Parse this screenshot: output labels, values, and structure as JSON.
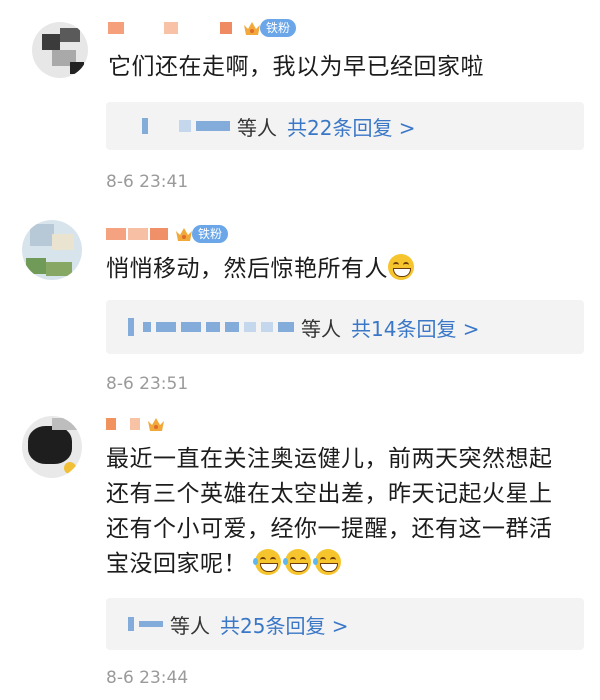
{
  "comments": [
    {
      "badge": "铁粉",
      "text": "它们还在走啊，我以为早已经回家啦",
      "reply_prefix": "等人",
      "reply_link": "共22条回复 >",
      "time": "8-6 23:41"
    },
    {
      "badge": "铁粉",
      "text": "悄悄移动，然后惊艳所有人",
      "emoji": "grinning-face-emoji",
      "reply_prefix": "等人",
      "reply_link": "共14条回复 >",
      "time": "8-6 23:51"
    },
    {
      "badge": "",
      "text_lines": [
        "最近一直在关注奥运健儿，前两天突然想起",
        "还有三个英雄在太空出差，昨天记起火星上",
        "还有个小可爱，经你一提醒，还有这一群活",
        "宝没回家呢！"
      ],
      "emoji": "laughing-tears-emoji",
      "reply_prefix": "等人",
      "reply_link": "共25条回复 >",
      "time": "8-6 23:44"
    }
  ],
  "colors": {
    "link": "#3a77c7",
    "badge": "#6aa6e8",
    "time": "#9a9a9a",
    "reply_bg": "#f3f3f3"
  }
}
